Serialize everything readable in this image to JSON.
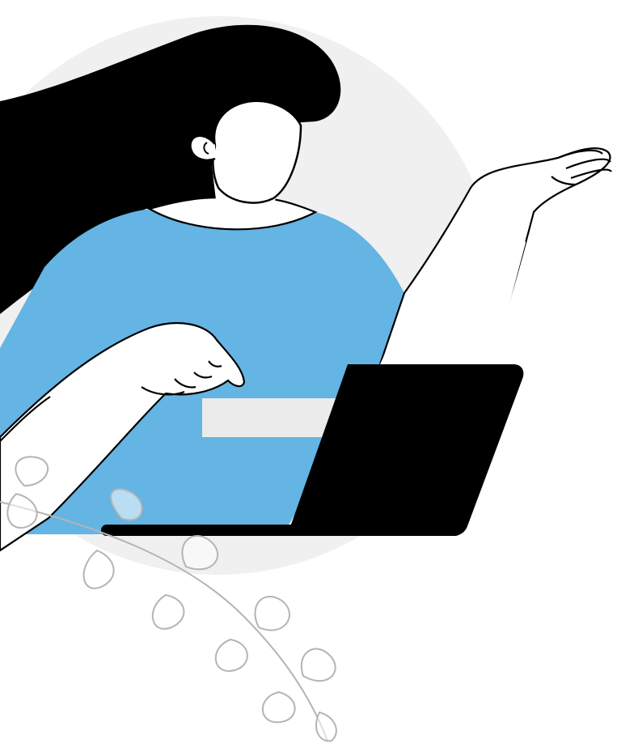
{
  "illustration": {
    "subject": "person-with-laptop",
    "colors": {
      "background": "#ffffff",
      "backdrop_circle": "#f0f0f0",
      "hair": "#000000",
      "shirt": "#64b4e4",
      "skin": "#ffffff",
      "outline": "#000000",
      "laptop": "#000000",
      "desk_card": "#ebebeb",
      "leaf_outline": "#b4b4b4"
    }
  }
}
